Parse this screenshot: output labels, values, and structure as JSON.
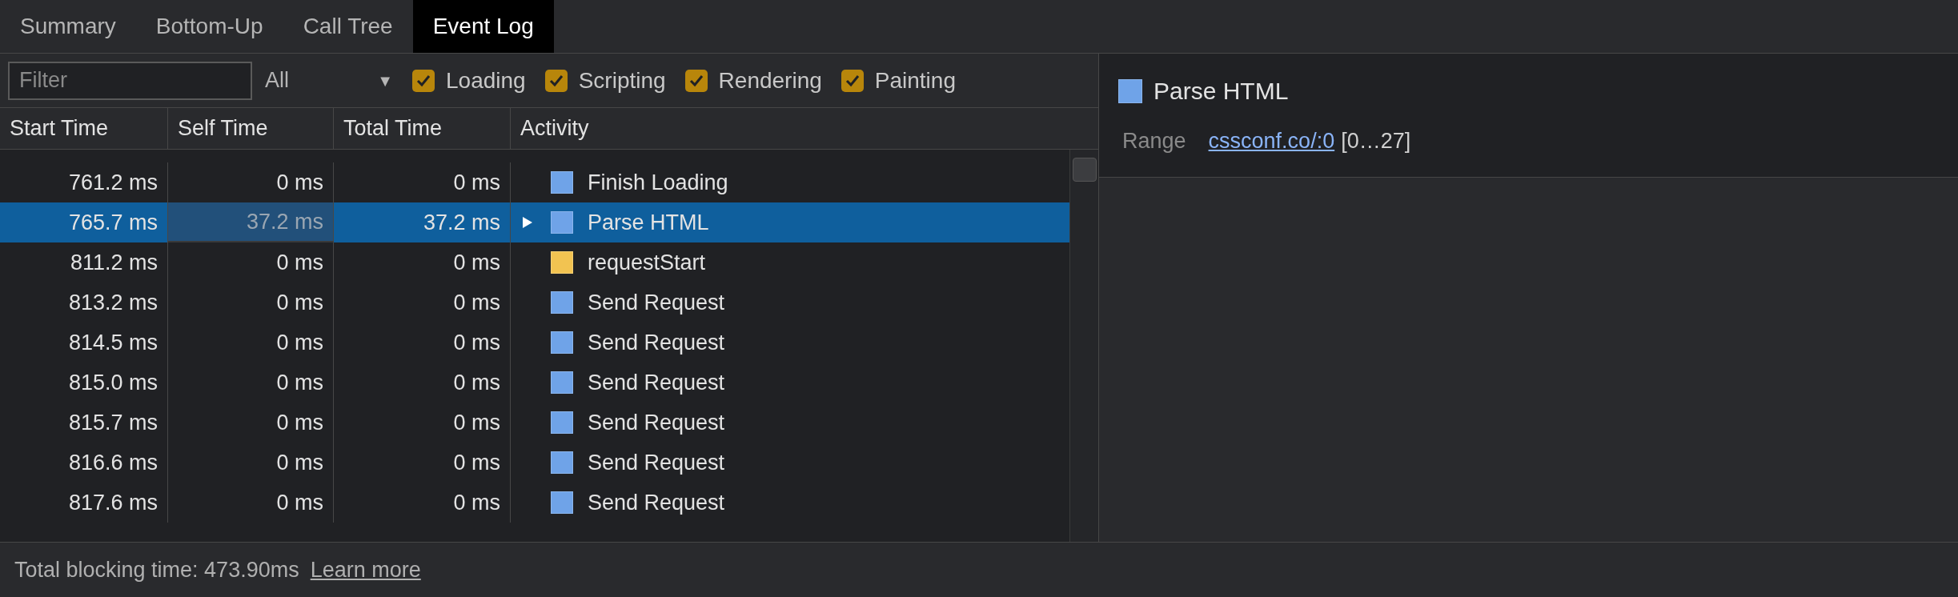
{
  "tabs": [
    {
      "label": "Summary",
      "selected": false
    },
    {
      "label": "Bottom-Up",
      "selected": false
    },
    {
      "label": "Call Tree",
      "selected": false
    },
    {
      "label": "Event Log",
      "selected": true
    }
  ],
  "filter": {
    "placeholder": "Filter",
    "dropdown": "All",
    "dropdown_arrow": "▼",
    "checkboxes": [
      {
        "label": "Loading",
        "checked": true
      },
      {
        "label": "Scripting",
        "checked": true
      },
      {
        "label": "Rendering",
        "checked": true
      },
      {
        "label": "Painting",
        "checked": true
      }
    ]
  },
  "table": {
    "columns": [
      "Start Time",
      "Self Time",
      "Total Time",
      "Activity"
    ],
    "rows": [
      {
        "start": "761.2 ms",
        "self": "0 ms",
        "total": "0 ms",
        "activity": "Finish Loading",
        "color": "#6fa3e8",
        "selected": false,
        "expandable": false
      },
      {
        "start": "765.7 ms",
        "self": "37.2 ms",
        "total": "37.2 ms",
        "activity": "Parse HTML",
        "color": "#6fa3e8",
        "selected": true,
        "expandable": true
      },
      {
        "start": "811.2 ms",
        "self": "0 ms",
        "total": "0 ms",
        "activity": "requestStart",
        "color": "#f2c351",
        "selected": false,
        "expandable": false
      },
      {
        "start": "813.2 ms",
        "self": "0 ms",
        "total": "0 ms",
        "activity": "Send Request",
        "color": "#6fa3e8",
        "selected": false,
        "expandable": false
      },
      {
        "start": "814.5 ms",
        "self": "0 ms",
        "total": "0 ms",
        "activity": "Send Request",
        "color": "#6fa3e8",
        "selected": false,
        "expandable": false
      },
      {
        "start": "815.0 ms",
        "self": "0 ms",
        "total": "0 ms",
        "activity": "Send Request",
        "color": "#6fa3e8",
        "selected": false,
        "expandable": false
      },
      {
        "start": "815.7 ms",
        "self": "0 ms",
        "total": "0 ms",
        "activity": "Send Request",
        "color": "#6fa3e8",
        "selected": false,
        "expandable": false
      },
      {
        "start": "816.6 ms",
        "self": "0 ms",
        "total": "0 ms",
        "activity": "Send Request",
        "color": "#6fa3e8",
        "selected": false,
        "expandable": false
      },
      {
        "start": "817.6 ms",
        "self": "0 ms",
        "total": "0 ms",
        "activity": "Send Request",
        "color": "#6fa3e8",
        "selected": false,
        "expandable": false
      }
    ]
  },
  "details": {
    "title": "Parse HTML",
    "color": "#6fa3e8",
    "range_label": "Range",
    "range_link": "cssconf.co/:0",
    "range_suffix": "[0…27]"
  },
  "status_bar": {
    "text": "Total blocking time: 473.90ms",
    "link": "Learn more"
  }
}
